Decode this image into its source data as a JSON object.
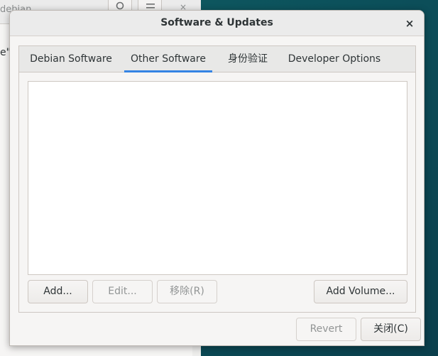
{
  "background_window": {
    "title_fragment": "debian",
    "text_fragment": "e\"",
    "close_glyph": "×"
  },
  "dialog": {
    "title": "Software & Updates",
    "close_glyph": "×"
  },
  "tabs": [
    {
      "label": "Debian Software",
      "active": false
    },
    {
      "label": "Other Software",
      "active": true
    },
    {
      "label": "身份验证",
      "active": false
    },
    {
      "label": "Developer Options",
      "active": false
    }
  ],
  "buttons": {
    "add": "Add...",
    "edit": "Edit...",
    "remove": "移除(R)",
    "add_volume": "Add Volume...",
    "revert": "Revert",
    "close": "关闭(C)"
  },
  "colors": {
    "accent": "#3584e4",
    "desktop": "#0c4f5a"
  }
}
